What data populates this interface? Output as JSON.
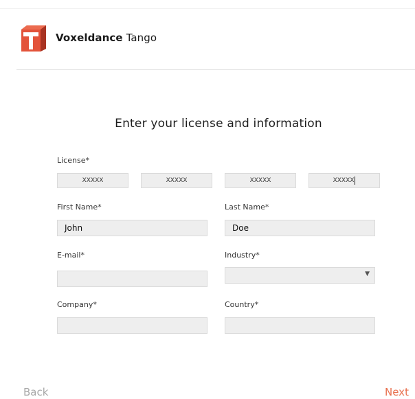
{
  "app": {
    "brand_primary": "Voxeldance",
    "brand_secondary": "Tango",
    "logo_icon": "voxeldance-t-logo",
    "accent_color": "#e8704e"
  },
  "form": {
    "title": "Enter your license and information",
    "license": {
      "label": "License*",
      "parts": [
        "XXXXX",
        "XXXXX",
        "XXXXX",
        "XXXXX"
      ]
    },
    "first_name": {
      "label": "First Name*",
      "value": "John"
    },
    "last_name": {
      "label": "Last Name*",
      "value": "Doe"
    },
    "email": {
      "label": "E-mail*",
      "value": ""
    },
    "industry": {
      "label": "Industry*",
      "value": ""
    },
    "company": {
      "label": "Company*",
      "value": ""
    },
    "country": {
      "label": "Country*",
      "value": ""
    }
  },
  "footer": {
    "back_label": "Back",
    "next_label": "Next"
  }
}
